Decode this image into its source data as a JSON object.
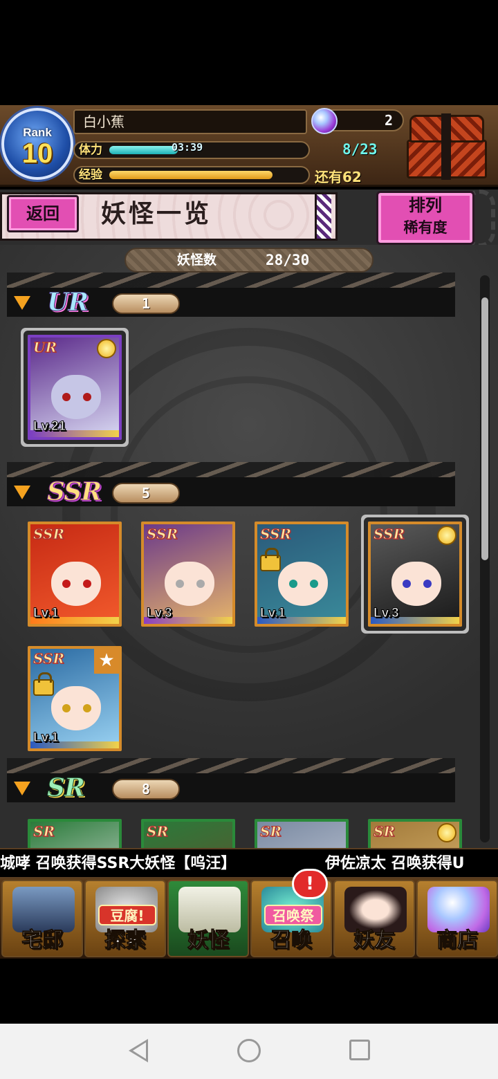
{
  "header": {
    "rank_label": "Rank",
    "rank_value": "10",
    "player_name": "白小蕉",
    "stamina_label": "体力",
    "stamina_timer": "03:39",
    "stamina_value": "8/23",
    "stamina_fill": 0.35,
    "exp_label": "经验",
    "exp_remaining": "还有62",
    "exp_fill": 0.83,
    "gem_count": "2"
  },
  "title_bar": {
    "back_label": "返回",
    "title": "妖怪一览",
    "sort_line1": "排列",
    "sort_line2": "稀有度"
  },
  "summary": {
    "label": "妖怪数",
    "value": "28/30"
  },
  "sections": [
    {
      "rarity": "UR",
      "count": "1",
      "cards": [
        {
          "tag": "UR",
          "level": "Lv.21",
          "medal": true,
          "selected": true
        }
      ]
    },
    {
      "rarity": "SSR",
      "count": "5",
      "cards": [
        {
          "tag": "SSR",
          "level": "Lv.1"
        },
        {
          "tag": "SSR",
          "level": "Lv.3"
        },
        {
          "tag": "SSR",
          "level": "Lv.1",
          "locked": true
        },
        {
          "tag": "SSR",
          "level": "Lv.3",
          "medal": true,
          "selected": true
        },
        {
          "tag": "SSR",
          "level": "Lv.1",
          "locked": true,
          "star": true
        }
      ]
    },
    {
      "rarity": "SR",
      "count": "8",
      "cards": [
        {
          "tag": "SR"
        },
        {
          "tag": "SR"
        },
        {
          "tag": "SR"
        },
        {
          "tag": "SR",
          "medal": true
        }
      ]
    }
  ],
  "ticker": {
    "message1": "城哮 召唤获得SSR大妖怪【呜汪】",
    "message2": "伊佐凉太 召唤获得U"
  },
  "nav": [
    {
      "label": "宅邸",
      "icon": "house-icon"
    },
    {
      "label": "探索",
      "icon": "explore-icon",
      "chip": "豆腐!"
    },
    {
      "label": "妖怪",
      "icon": "yokai-scroll-icon",
      "active": true
    },
    {
      "label": "召唤",
      "icon": "summon-star-icon",
      "chip": "召唤祭"
    },
    {
      "label": "妖友",
      "icon": "friend-catgirl-icon"
    },
    {
      "label": "商店",
      "icon": "shop-orb-icon"
    }
  ],
  "nav_badge": "!",
  "colors": {
    "stamina": "#1db0b5",
    "exp": "#e09a1a",
    "accent_pink": "#e24fb3",
    "section_triangle": "#f5a21f"
  }
}
